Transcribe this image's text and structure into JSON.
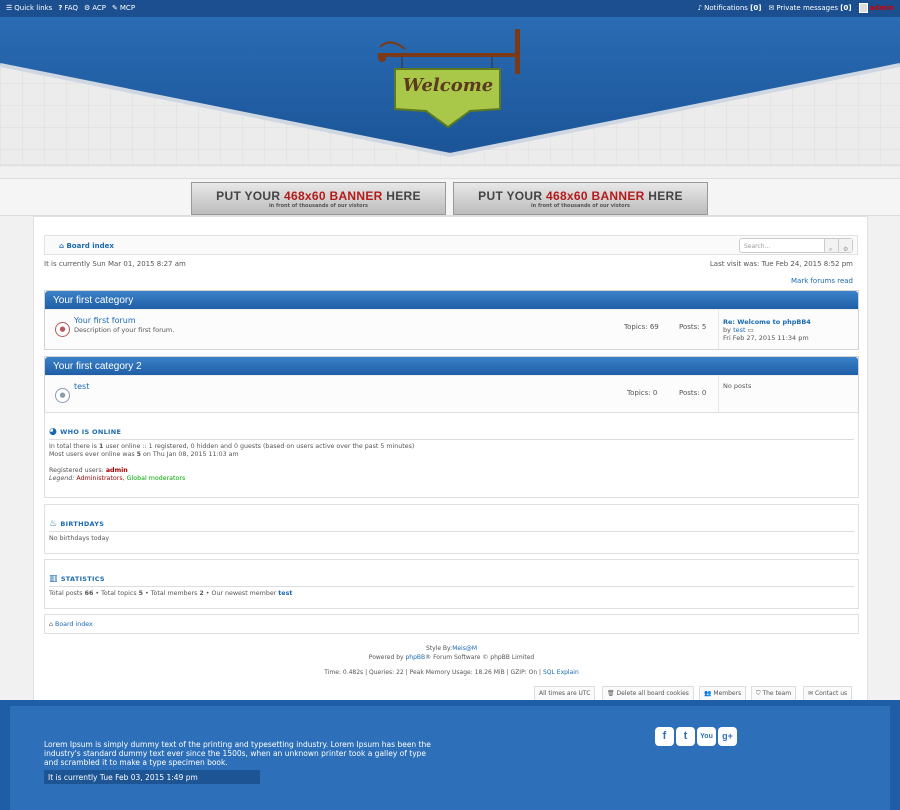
{
  "topbar": {
    "quick_links": "Quick links",
    "faq": "FAQ",
    "acp": "ACP",
    "mcp": "MCP",
    "notifications": "Notifications",
    "notifications_count": "[0]",
    "private_messages": "Private messages",
    "pm_count": "[0]",
    "username": "admin"
  },
  "header": {
    "sign_text": "Welcome"
  },
  "banners": [
    {
      "main": "PUT YOUR",
      "highlight": "468x60 BANNER",
      "tail": "HERE",
      "sub": "in front of thousands of our vistors"
    },
    {
      "main": "PUT YOUR",
      "highlight": "468x60 BANNER",
      "tail": "HERE",
      "sub": "in front of thousands of our vistors"
    }
  ],
  "nav": {
    "board_index": "Board index",
    "search_placeholder": "Search…"
  },
  "info": {
    "current_time": "It is currently Sun Mar 01, 2015 8:27 am",
    "last_visit": "Last visit was: Tue Feb 24, 2015 8:52 pm",
    "mark_read": "Mark forums read"
  },
  "categories": [
    {
      "title": "Your first category",
      "forum": {
        "title": "Your first forum",
        "desc": "Description of your first forum.",
        "topics": "Topics: 69",
        "posts": "Posts: 5",
        "last_title": "Re: Welcome to phpBB4",
        "last_by_prefix": "by",
        "last_by": "test",
        "last_date": "Fri Feb 27, 2015 11:34 pm"
      }
    },
    {
      "title": "Your first category 2",
      "forum": {
        "title": "test",
        "desc": "",
        "topics": "Topics: 0",
        "posts": "Posts: 0",
        "last_title": "No posts"
      }
    }
  ],
  "online": {
    "title": "WHO IS ONLINE",
    "line1_a": "In total there is",
    "line1_b": "1",
    "line1_c": "user online :: 1 registered, 0 hidden and 0 guests (based on users active over the past 5 minutes)",
    "line2_a": "Most users ever online was",
    "line2_b": "5",
    "line2_c": "on Thu Jan 08, 2015 11:03 am",
    "registered_label": "Registered users:",
    "registered_user": "admin",
    "legend_label": "Legend:",
    "legend_admins": "Administrators",
    "legend_sep": ",",
    "legend_mods": "Global moderators"
  },
  "birthdays": {
    "title": "BIRTHDAYS",
    "text": "No birthdays today"
  },
  "statistics": {
    "title": "STATISTICS",
    "posts_label": "Total posts",
    "posts": "66",
    "topics_label": "• Total topics",
    "topics": "5",
    "members_label": "• Total members",
    "members": "2",
    "newest_label": "• Our newest member",
    "newest": "test"
  },
  "footer": {
    "board_index": "Board index",
    "style_by": "Style By:",
    "style_author": "Meis@M",
    "powered_a": "Powered by",
    "powered_link": "phpBB",
    "powered_b": "® Forum Software © phpBB Limited",
    "debug": "Time: 0.482s | Queries: 22 | Peak Memory Usage: 18.26 MiB | GZIP: On |",
    "sql_explain": "SQL Explain",
    "links": [
      "All times are UTC",
      "Delete all board cookies",
      "Members",
      "The team",
      "Contact us"
    ]
  },
  "bottom": {
    "lorem": "Lorem Ipsum is simply dummy text of the printing and typesetting industry. Lorem Ipsum has been the industry's standard dummy text ever since the 1500s, when an unknown printer took a galley of type and scrambled it to make a type specimen book.",
    "clock": "It is currently Tue Feb 03, 2015 1:49 pm",
    "social": [
      {
        "icon": "facebook-icon",
        "glyph": "f"
      },
      {
        "icon": "twitter-icon",
        "glyph": "t"
      },
      {
        "icon": "youtube-icon",
        "glyph": "You"
      },
      {
        "icon": "googleplus-icon",
        "glyph": "g+"
      }
    ]
  },
  "colors": {
    "brand_blue": "#1f5ea6",
    "accent_link": "#1a6ab0",
    "admin_red": "#aa0000",
    "mod_green": "#00aa00"
  }
}
